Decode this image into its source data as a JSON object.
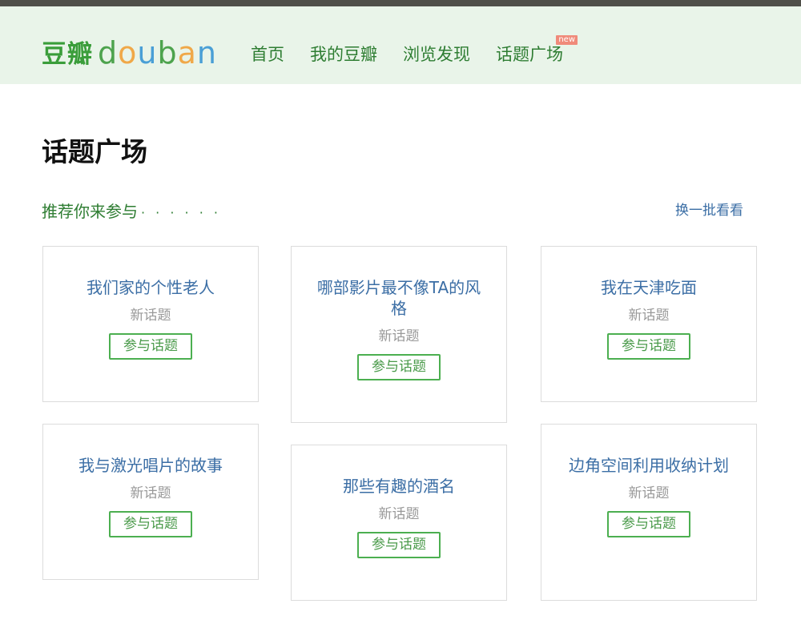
{
  "header": {
    "logo_cn": "豆瓣",
    "logo_en": [
      "d",
      "o",
      "u",
      "b",
      "a",
      "n"
    ],
    "nav": [
      {
        "label": "首页"
      },
      {
        "label": "我的豆瓣"
      },
      {
        "label": "浏览发现"
      },
      {
        "label": "话题广场",
        "badge": "new"
      }
    ]
  },
  "page": {
    "title": "话题广场",
    "section_title": "推荐你来参与",
    "section_dots": "· · · · · ·",
    "refresh_label": "换一批看看"
  },
  "topics": [
    {
      "title": "我们家的个性老人",
      "sub": "新话题",
      "button": "参与话题"
    },
    {
      "title": "哪部影片最不像TA的风格",
      "sub": "新话题",
      "button": "参与话题"
    },
    {
      "title": "我在天津吃面",
      "sub": "新话题",
      "button": "参与话题"
    },
    {
      "title": "我与激光唱片的故事",
      "sub": "新话题",
      "button": "参与话题"
    },
    {
      "title": "那些有趣的酒名",
      "sub": "新话题",
      "button": "参与话题"
    },
    {
      "title": "边角空间利用收纳计划",
      "sub": "新话题",
      "button": "参与话题"
    }
  ]
}
